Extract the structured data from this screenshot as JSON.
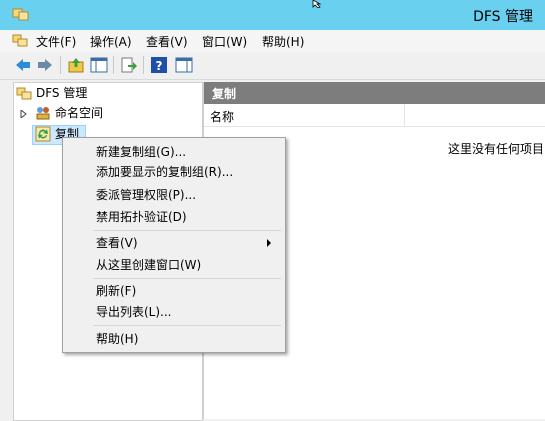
{
  "window": {
    "title": "DFS 管理"
  },
  "menubar": {
    "items": [
      "文件(F)",
      "操作(A)",
      "查看(V)",
      "窗口(W)",
      "帮助(H)"
    ]
  },
  "toolbar": {
    "buttons": [
      "back-arrow-icon",
      "forward-arrow-icon",
      "up-folder-icon",
      "show-tree-icon",
      "export-icon",
      "help-icon",
      "show-action-pane-icon"
    ]
  },
  "tree": {
    "root": "DFS 管理",
    "children": [
      "命名空间",
      "复制"
    ],
    "selected": "复制"
  },
  "right_pane": {
    "header": "复制",
    "column_name": "名称",
    "empty_text": "这里没有任何项目"
  },
  "context_menu": {
    "items": [
      "新建复制组(G)...",
      "添加要显示的复制组(R)...",
      "委派管理权限(P)...",
      "禁用拓扑验证(D)",
      "查看(V)",
      "从这里创建窗口(W)",
      "刷新(F)",
      "导出列表(L)...",
      "帮助(H)"
    ]
  }
}
